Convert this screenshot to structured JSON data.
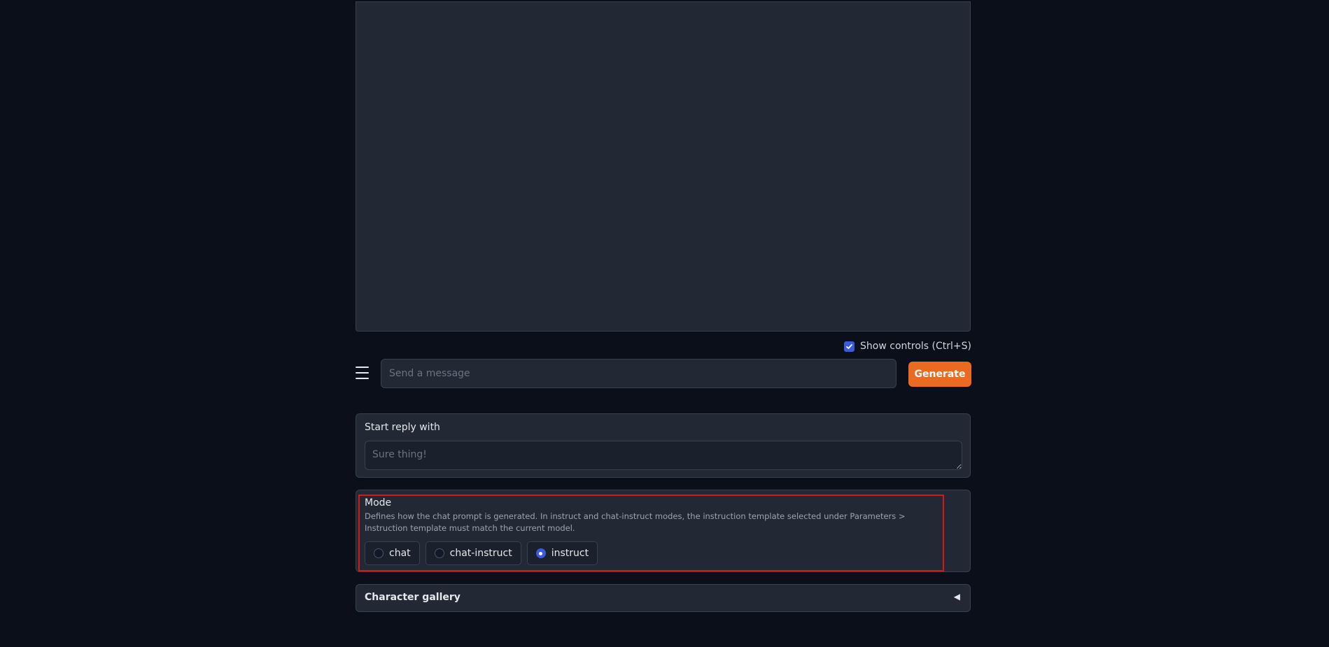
{
  "show_controls": {
    "label": "Show controls (Ctrl+S)",
    "checked": true
  },
  "input": {
    "placeholder": "Send a message"
  },
  "generate": {
    "label": "Generate"
  },
  "start_reply": {
    "label": "Start reply with",
    "placeholder": "Sure thing!"
  },
  "mode": {
    "label": "Mode",
    "description": "Defines how the chat prompt is generated. In instruct and chat-instruct modes, the instruction template selected under Parameters > Instruction template must match the current model.",
    "options": [
      "chat",
      "chat-instruct",
      "instruct"
    ],
    "selected": "instruct"
  },
  "character_gallery": {
    "label": "Character gallery",
    "arrow": "◀"
  },
  "icons": {
    "menu": "hamburger-menu-icon",
    "check": "checkmark-icon"
  },
  "colors": {
    "accent": "#ea6a22",
    "selection": "#3b5bdb",
    "highlight_border": "#d11a1a"
  }
}
